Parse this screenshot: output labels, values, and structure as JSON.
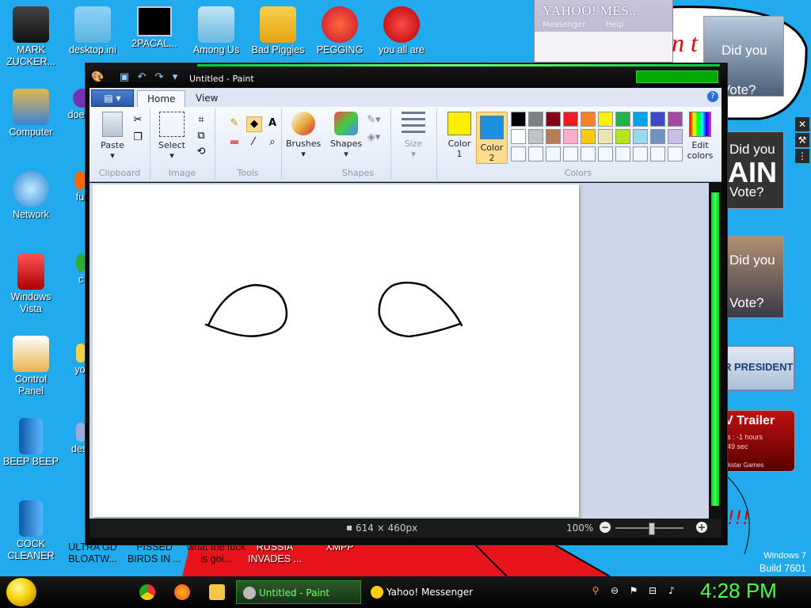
{
  "desktop": {
    "icons": [
      {
        "label": "MARK ZUCKER...",
        "name": "mark-zuckerberg"
      },
      {
        "label": "desktop.ini",
        "name": "desktop-ini"
      },
      {
        "label": "2PACAL...",
        "name": "2pacal"
      },
      {
        "label": "Among Us",
        "name": "among-us"
      },
      {
        "label": "Bad Piggies",
        "name": "bad-piggies"
      },
      {
        "label": "PEGGING",
        "name": "pegging"
      },
      {
        "label": "you all are",
        "name": "you-all-are"
      },
      {
        "label": "Computer",
        "name": "computer"
      },
      {
        "label": "doe",
        "name": "doe"
      },
      {
        "label": "Network",
        "name": "network"
      },
      {
        "label": "fu",
        "name": "fu"
      },
      {
        "label": "Windows Vista",
        "name": "windows-vista"
      },
      {
        "label": "c",
        "name": "c"
      },
      {
        "label": "Control Panel",
        "name": "control-panel"
      },
      {
        "label": "yo",
        "name": "yo"
      },
      {
        "label": "BEEP BEEP",
        "name": "beep-beep"
      },
      {
        "label": "des",
        "name": "des"
      },
      {
        "label": "COCK CLEANER",
        "name": "cock-cleaner"
      },
      {
        "label": "ULTRA GD BLOATW...",
        "name": "ultra-gd"
      },
      {
        "label": "PISSED BIRDS IN ...",
        "name": "pissed-birds"
      },
      {
        "label": "what the fuck is goi...",
        "name": "what-the"
      },
      {
        "label": "RUSSIA INVADES ...",
        "name": "russia-invades"
      },
      {
        "label": "XMPP",
        "name": "xmpp"
      }
    ],
    "watermark": {
      "line1": "Windows 7",
      "line2": "Build 7601"
    }
  },
  "yahoo": {
    "title": "YAHOO! MES...",
    "menu1": "Messenger",
    "menu2": "Help"
  },
  "ads": {
    "ad1_text": "Did you Vote?",
    "ad2_text": "Did you",
    "ad2_big": "AIN",
    "ad2_sub": "Vote?",
    "ad3_text": "Did you",
    "ad3_sub": "Vote?",
    "ad4_text": "R PRESIDENT",
    "ad5_title": "V Trailer",
    "ad5_line1": "rs : -1 hours",
    "ad5_line2": "-49 sec",
    "ad5_foot": "ckstar Games",
    "top_text": "n t",
    "exclaim": "!!!"
  },
  "paint": {
    "title": "Untitled - Paint",
    "tabs": [
      "Home",
      "View"
    ],
    "groups": {
      "clipboard": "Clipboard",
      "image": "Image",
      "tools": "Tools",
      "shapes": "Shapes",
      "colors": "Colors"
    },
    "buttons": {
      "paste": "Paste",
      "select": "Select",
      "brushes": "Brushes",
      "shapes": "Shapes",
      "size": "Size",
      "color1_a": "Color",
      "color1_b": "1",
      "color2_a": "Color",
      "color2_b": "2",
      "edit_a": "Edit",
      "edit_b": "colors"
    },
    "color1": "#ffee00",
    "color2": "#1e90e0",
    "palette_row1": [
      "#000000",
      "#7f7f7f",
      "#880015",
      "#ed1c24",
      "#ff7f27",
      "#fff200",
      "#22b14c",
      "#00a2e8",
      "#3f48cc",
      "#a349a4"
    ],
    "palette_row2": [
      "#ffffff",
      "#c3c3c3",
      "#b97a57",
      "#ffaec9",
      "#ffc90e",
      "#efe4b0",
      "#b5e61d",
      "#99d9ea",
      "#7092be",
      "#c8bfe7"
    ],
    "status": {
      "dims": "614 × 460px",
      "zoom": "100%"
    }
  },
  "taskbar": {
    "tasks": [
      {
        "label": "Untitled - Paint"
      },
      {
        "label": "Yahoo! Messenger"
      }
    ],
    "clock": "4:28 PM"
  }
}
